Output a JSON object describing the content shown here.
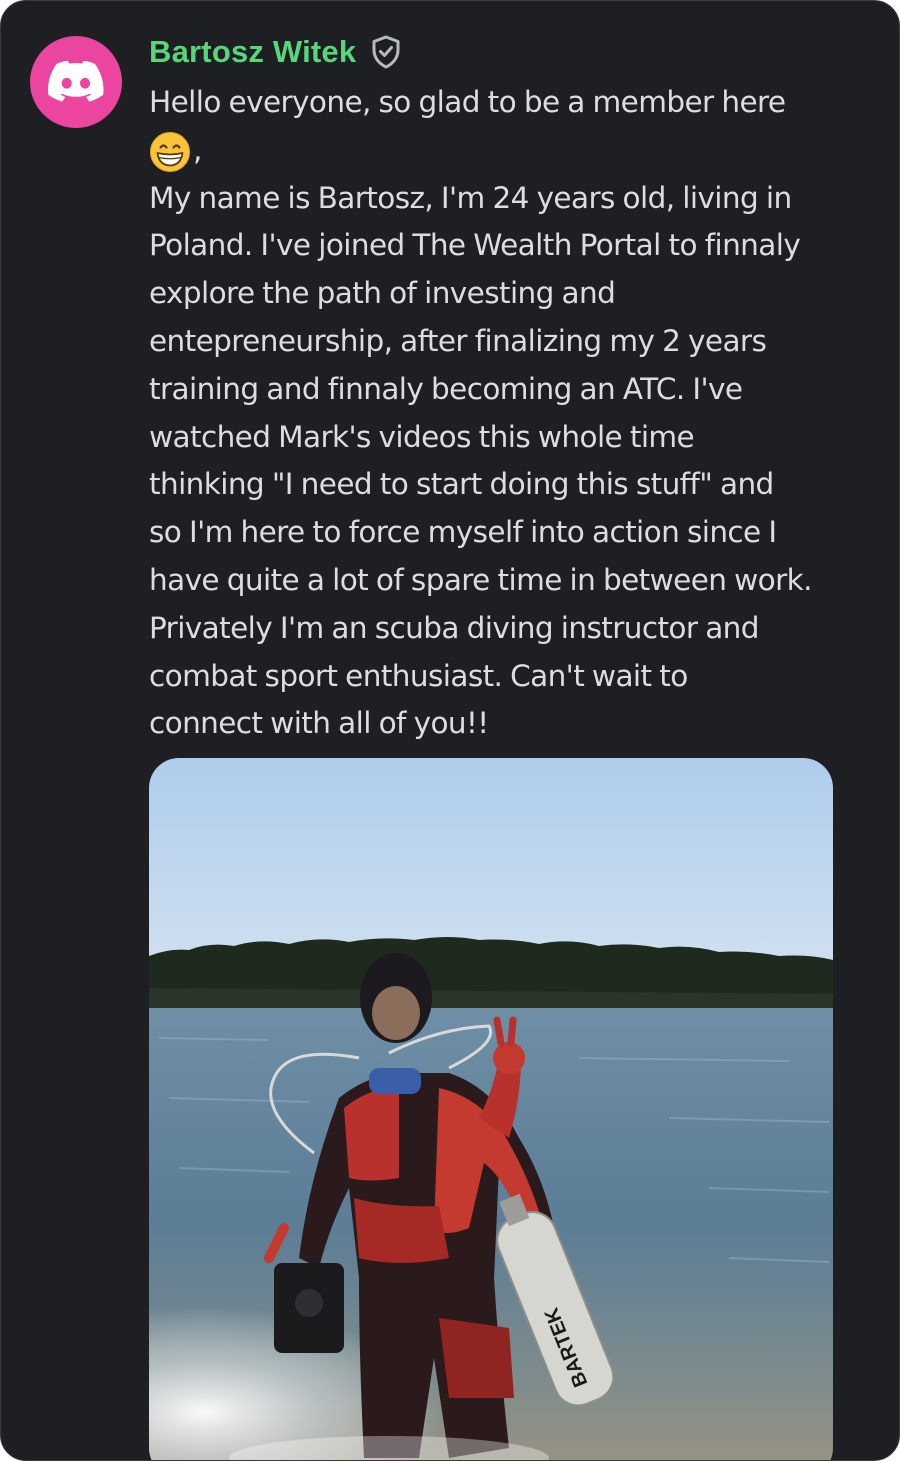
{
  "author": {
    "name": "Bartosz Witek",
    "avatar_icon": "discord-logo-icon",
    "avatar_color": "#eb459f",
    "name_color": "#57d67a",
    "badge_icon": "verified-shield-icon"
  },
  "message": {
    "lines": [
      "Hello everyone, so glad to be a member here",
      "My name is Bartosz, I'm 24 years old, living in",
      "Poland. I've joined The Wealth Portal to finnaly",
      "explore the path of investing and",
      "entepreneurship, after finalizing my 2 years",
      "training and finnaly becoming an ATC. I've",
      "watched Mark's videos this whole time",
      "thinking \"I need to start doing this stuff\" and",
      "so I'm here to force myself into action since I",
      "have quite a lot of spare time in between work.",
      "Privately I'm an scuba diving instructor and",
      "combat sport enthusiast. Can't wait to",
      "connect with all of you!!"
    ],
    "emoji_icon": "grinning-face-emoji",
    "emoji_suffix": ","
  },
  "attachment": {
    "type": "photo",
    "tank_text": "BARTEK"
  }
}
